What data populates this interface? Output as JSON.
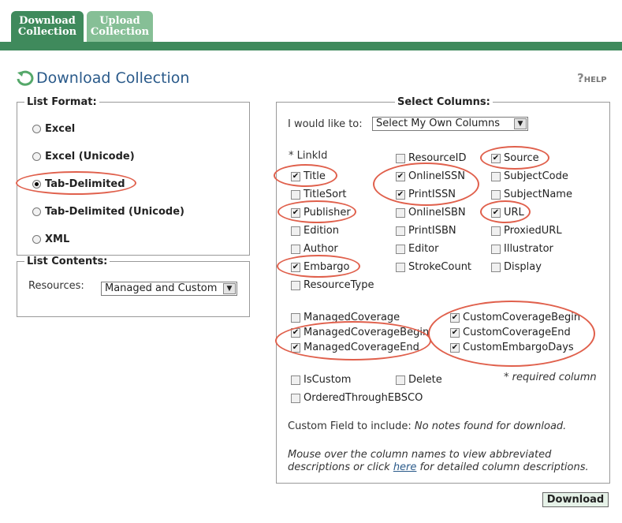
{
  "tabs": [
    {
      "label_line1": "Download",
      "label_line2": "Collection"
    },
    {
      "label_line1": "Upload",
      "label_line2": "Collection"
    }
  ],
  "page_title": "Download Collection",
  "help_label": "HELP",
  "list_format": {
    "legend": "List Format:",
    "options": [
      "Excel",
      "Excel (Unicode)",
      "Tab-Delimited",
      "Tab-Delimited (Unicode)",
      "XML"
    ],
    "selected": "Tab-Delimited"
  },
  "list_contents": {
    "legend": "List Contents:",
    "resources_label": "Resources:",
    "resources_value": "Managed and Custom"
  },
  "select_columns": {
    "legend": "Select Columns:",
    "like_label": "I would like to:",
    "like_value": "Select My Own Columns",
    "linkid": "* LinkId",
    "columns": {
      "title": "Title",
      "titlesort": "TitleSort",
      "publisher": "Publisher",
      "edition": "Edition",
      "author": "Author",
      "embargo": "Embargo",
      "resourcetype": "ResourceType",
      "resourceid": "ResourceID",
      "onlineissn": "OnlineISSN",
      "printissn": "PrintISSN",
      "onlineisbn": "OnlineISBN",
      "printisbn": "PrintISBN",
      "editor": "Editor",
      "strokecount": "StrokeCount",
      "source": "Source",
      "subjectcode": "SubjectCode",
      "subjectname": "SubjectName",
      "url": "URL",
      "proxiedurl": "ProxiedURL",
      "illustrator": "Illustrator",
      "display": "Display",
      "managedcoverage": "ManagedCoverage",
      "managedcoveragebegin": "ManagedCoverageBegin",
      "managedcoverageend": "ManagedCoverageEnd",
      "customcoveragebegin": "CustomCoverageBegin",
      "customcoverageend": "CustomCoverageEnd",
      "customembargodays": "CustomEmbargoDays",
      "iscustom": "IsCustom",
      "delete": "Delete",
      "orderedthroughebsco": "OrderedThroughEBSCO"
    },
    "required_note": "* required column",
    "custom_field_label": "Custom Field to include:",
    "custom_field_value": "No notes found for download.",
    "mouse_note_1": "Mouse over the column names to view abbreviated",
    "mouse_note_2a": "descriptions or click",
    "mouse_note_link": "here",
    "mouse_note_2b": "for detailed column descriptions."
  },
  "download_button": "Download",
  "colors": {
    "tab_active": "#3f8a5c",
    "tab_inactive": "#86bf96",
    "title": "#2a5a8a",
    "annotation": "#e0604c"
  }
}
